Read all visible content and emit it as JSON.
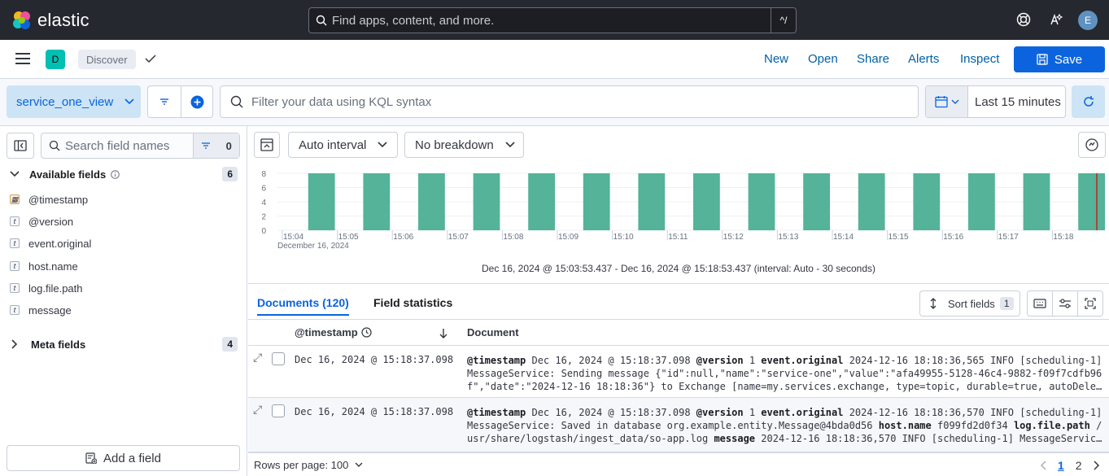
{
  "topbar": {
    "brand": "elastic",
    "search_placeholder": "Find apps, content, and more.",
    "shortcut": "^/",
    "user_initial": "E"
  },
  "appbar": {
    "space_initial": "D",
    "breadcrumb": "Discover",
    "links": [
      "New",
      "Open",
      "Share",
      "Alerts",
      "Inspect"
    ],
    "save_label": "Save"
  },
  "querybar": {
    "data_view": "service_one_view",
    "kql_placeholder": "Filter your data using KQL syntax",
    "time_range": "Last 15 minutes"
  },
  "sidebar": {
    "search_placeholder": "Search field names",
    "filter_count": "0",
    "available_label": "Available fields",
    "available_count": "6",
    "fields": [
      {
        "name": "@timestamp",
        "type": "date"
      },
      {
        "name": "@version",
        "type": "t"
      },
      {
        "name": "event.original",
        "type": "t"
      },
      {
        "name": "host.name",
        "type": "t"
      },
      {
        "name": "log.file.path",
        "type": "t"
      },
      {
        "name": "message",
        "type": "t"
      }
    ],
    "meta_label": "Meta fields",
    "meta_count": "4",
    "add_field_label": "Add a field"
  },
  "histogram_toolbar": {
    "interval": "Auto interval",
    "breakdown": "No breakdown"
  },
  "chart_data": {
    "type": "bar",
    "y_ticks": [
      "8",
      "6",
      "4",
      "2",
      "0"
    ],
    "ylim": [
      0,
      8
    ],
    "x_tick_labels": [
      "15:04",
      "15:05",
      "15:06",
      "15:07",
      "15:08",
      "15:09",
      "15:10",
      "15:11",
      "15:12",
      "15:13",
      "15:14",
      "15:15",
      "15:16",
      "15:17",
      "15:18"
    ],
    "x_date_label": "December 16, 2024",
    "values": [
      0,
      8,
      0,
      8,
      0,
      8,
      0,
      8,
      0,
      8,
      0,
      8,
      0,
      8,
      0,
      8,
      0,
      8,
      0,
      8,
      0,
      8,
      0,
      8,
      0,
      8,
      0,
      8,
      0,
      8
    ],
    "bar_color": "#54b399"
  },
  "time_range_text": "Dec 16, 2024 @ 15:03:53.437 - Dec 16, 2024 @ 15:18:53.437 (interval: Auto - 30 seconds)",
  "documents": {
    "tab_documents": "Documents (120)",
    "tab_field_stats": "Field statistics",
    "sort_label": "Sort fields",
    "sort_count": "1",
    "col_timestamp": "@timestamp",
    "col_document": "Document",
    "rows": [
      {
        "timestamp": "Dec 16, 2024 @ 15:18:37.098",
        "l1_pre": "",
        "l1": [
          {
            "k": "@timestamp",
            "v": "Dec 16, 2024 @ 15:18:37.098"
          },
          {
            "k": "@version",
            "v": "1"
          },
          {
            "k": "event.original",
            "v": "2024-12-16 18:18:36,565 INFO [scheduling-1]"
          }
        ],
        "l2": "MessageService: Sending message {\"id\":null,\"name\":\"service-one\",\"value\":\"afa49955-5128-46c4-9882-f09f7cdfb96",
        "l3": "f\",\"date\":\"2024-12-16 18:18:36\"} to Exchange [name=my.services.exchange, type=topic, durable=true, autoDele..."
      },
      {
        "timestamp": "Dec 16, 2024 @ 15:18:37.098",
        "l1": [
          {
            "k": "@timestamp",
            "v": "Dec 16, 2024 @ 15:18:37.098"
          },
          {
            "k": "@version",
            "v": "1"
          },
          {
            "k": "event.original",
            "v": "2024-12-16 18:18:36,570 INFO [scheduling-1]"
          }
        ],
        "l2_text": "MessageService: Saved in database org.example.entity.Message@4bda0d56",
        "l2_k1": "host.name",
        "l2_v1": "f099fd2d0f34",
        "l2_k2": "log.file.path",
        "l2_v2": "/",
        "l3_text": "usr/share/logstash/ingest_data/so-app.log",
        "l3_k": "message",
        "l3_v": "2024-12-16 18:18:36,570 INFO [scheduling-1] MessageServic..."
      }
    ],
    "rows_per_page": "Rows per page: 100",
    "pages": [
      "1",
      "2"
    ]
  }
}
